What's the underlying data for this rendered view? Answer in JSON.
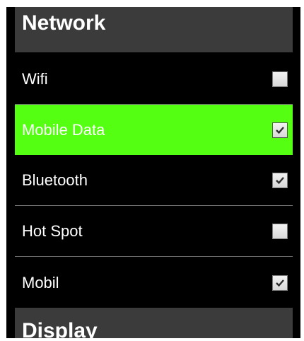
{
  "sections": {
    "network": {
      "title": "Network"
    },
    "display": {
      "title": "Display"
    }
  },
  "network_items": [
    {
      "label": "Wifi",
      "checked": false,
      "highlighted": false
    },
    {
      "label": "Mobile Data",
      "checked": true,
      "highlighted": true
    },
    {
      "label": "Bluetooth",
      "checked": true,
      "highlighted": false
    },
    {
      "label": "Hot Spot",
      "checked": false,
      "highlighted": false
    },
    {
      "label": "Mobil",
      "checked": true,
      "highlighted": false
    }
  ],
  "colors": {
    "highlight": "#55ff11",
    "background": "#000000",
    "section_header": "#3b3b3b"
  },
  "icons": {
    "check": "checkmark-icon"
  }
}
